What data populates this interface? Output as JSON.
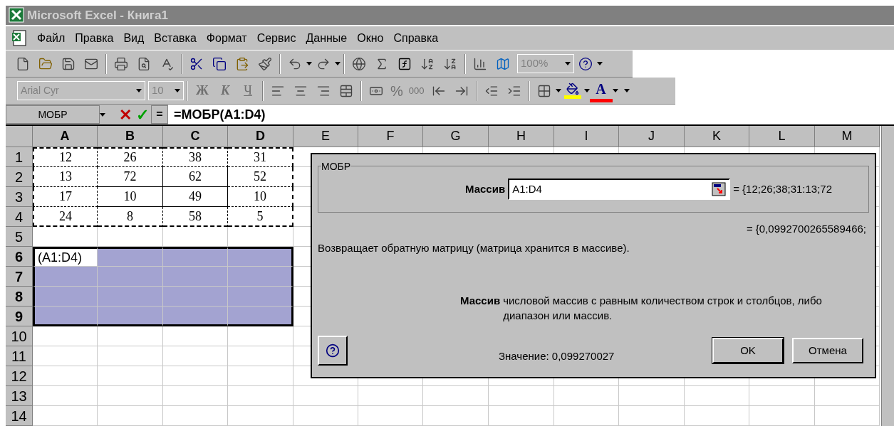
{
  "window": {
    "title": "Microsoft Excel - Книга1"
  },
  "menu": [
    {
      "label": "Файл"
    },
    {
      "label": "Правка"
    },
    {
      "label": "Вид"
    },
    {
      "label": "Вставка"
    },
    {
      "label": "Формат"
    },
    {
      "label": "Сервис"
    },
    {
      "label": "Данные"
    },
    {
      "label": "Окно"
    },
    {
      "label": "Справка"
    }
  ],
  "standard_toolbar": {
    "zoom": "100%"
  },
  "formatting_toolbar": {
    "font": "Arial Cyr",
    "size": "10",
    "style_buttons": [
      "Ж",
      "К",
      "Ч"
    ],
    "number_buttons": [
      "%",
      "000"
    ],
    "font_color_glyph": "A"
  },
  "formula_bar": {
    "name_box": "МОБР",
    "cancel": "✕",
    "enter": "✓",
    "equals": "=",
    "formula": "=МОБР(A1:D4)"
  },
  "sheet": {
    "columns": [
      {
        "label": "A",
        "selected": true
      },
      {
        "label": "B",
        "selected": true
      },
      {
        "label": "C",
        "selected": true
      },
      {
        "label": "D",
        "selected": true
      },
      {
        "label": "E",
        "selected": false
      },
      {
        "label": "F",
        "selected": false
      },
      {
        "label": "G",
        "selected": false
      },
      {
        "label": "H",
        "selected": false
      },
      {
        "label": "I",
        "selected": false
      },
      {
        "label": "J",
        "selected": false
      },
      {
        "label": "K",
        "selected": false
      },
      {
        "label": "L",
        "selected": false
      },
      {
        "label": "M",
        "selected": false
      }
    ],
    "rows": [
      {
        "header": "1",
        "selected": false,
        "marked": true,
        "cells": [
          "12",
          "26",
          "38",
          "31"
        ]
      },
      {
        "header": "2",
        "selected": false,
        "marked": true,
        "cells": [
          "13",
          "72",
          "62",
          "52"
        ]
      },
      {
        "header": "3",
        "selected": false,
        "marked": true,
        "cells": [
          "17",
          "10",
          "49",
          "10"
        ]
      },
      {
        "header": "4",
        "selected": false,
        "marked": true,
        "cells": [
          "24",
          "8",
          "58",
          "5"
        ]
      },
      {
        "header": "5",
        "selected": false,
        "marked": false,
        "cells": []
      },
      {
        "header": "6",
        "selected": true,
        "marked": false,
        "cells": [
          "(A1:D4)"
        ]
      },
      {
        "header": "7",
        "selected": true,
        "marked": false,
        "cells": []
      },
      {
        "header": "8",
        "selected": true,
        "marked": false,
        "cells": []
      },
      {
        "header": "9",
        "selected": true,
        "marked": false,
        "cells": []
      },
      {
        "header": "10",
        "selected": false,
        "marked": false,
        "cells": []
      },
      {
        "header": "11",
        "selected": false,
        "marked": false,
        "cells": []
      },
      {
        "header": "12",
        "selected": false,
        "marked": false,
        "cells": []
      },
      {
        "header": "13",
        "selected": false,
        "marked": false,
        "cells": []
      },
      {
        "header": "14",
        "selected": false,
        "marked": false,
        "cells": []
      }
    ]
  },
  "dialog": {
    "title": "МОБР",
    "argument_label": "Массив",
    "argument_value": "A1:D4",
    "argument_result": "= {12;26;38;31:13;72",
    "result": "= {0,0992700265589466;",
    "description": "Возвращает обратную матрицу (матрица хранится в массиве).",
    "help_name": "Массив",
    "help_text": "числовой массив с равным количеством строк и столбцов, либо диапазон или массив.",
    "value": "Значение: 0,099270027",
    "buttons": [
      "OK",
      "Отмена"
    ]
  }
}
